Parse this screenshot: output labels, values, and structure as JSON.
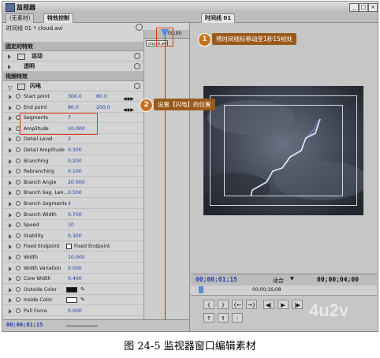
{
  "window": {
    "title": "监视器",
    "min": "_",
    "max": "□",
    "close": "×"
  },
  "left_tabs": [
    "(无素材)",
    "特效控制"
  ],
  "right_tab": "时间线 01",
  "clip_header": {
    "name": "时间线 01 * cloud.avi",
    "timecode": "00;00",
    "clip_label": "cloud.avi"
  },
  "sections": {
    "fixed": "固定的特效",
    "motion": "运动",
    "opacity": "透明",
    "video": "视频特效",
    "lightning": "闪电"
  },
  "params": [
    {
      "label": "Start point",
      "v1": "300.0",
      "v2": "60.0"
    },
    {
      "label": "End point",
      "v1": "80.0",
      "v2": "200.0"
    },
    {
      "label": "Segments",
      "v1": "7"
    },
    {
      "label": "Amplitude",
      "v1": "10.000"
    },
    {
      "label": "Detail Level",
      "v1": "2"
    },
    {
      "label": "Detail Amplitude",
      "v1": "0.300"
    },
    {
      "label": "Branching",
      "v1": "0.200"
    },
    {
      "label": "Rebranching",
      "v1": "0.100"
    },
    {
      "label": "Branch Angle",
      "v1": "20.000"
    },
    {
      "label": "Branch Seg. Len...",
      "v1": "0.500"
    },
    {
      "label": "Branch Segments",
      "v1": "4"
    },
    {
      "label": "Branch Width",
      "v1": "0.700"
    },
    {
      "label": "Speed",
      "v1": "10"
    },
    {
      "label": "Stability",
      "v1": "0.300"
    },
    {
      "label": "Fixed Endpoint",
      "v1": "Fixed Endpoint"
    },
    {
      "label": "Width",
      "v1": "10.000"
    },
    {
      "label": "Width Variation",
      "v1": "0.000"
    },
    {
      "label": "Core Width",
      "v1": "0.400"
    },
    {
      "label": "Outside Color",
      "v1": ""
    },
    {
      "label": "Inside Color",
      "v1": ""
    },
    {
      "label": "Pull Force",
      "v1": "0.000"
    }
  ],
  "bottom_left_timecode": "00;00;01;15",
  "monitor": {
    "current_tc": "00;00;01;15",
    "fit": "适合",
    "duration_tc": "00;00;04;00",
    "ruler_tc": "00;00;16;08"
  },
  "callouts": [
    {
      "num": "1",
      "text": "将时间线标移动至1秒15帧处"
    },
    {
      "num": "2",
      "text": "设置【闪电】的位置"
    }
  ],
  "watermark": "4u2v",
  "caption": "图 24-5   监视器窗口编辑素材",
  "colors": {
    "accent_orange": "#c8701c",
    "timecode_blue": "#2340a8",
    "playhead_red": "#e02020"
  }
}
